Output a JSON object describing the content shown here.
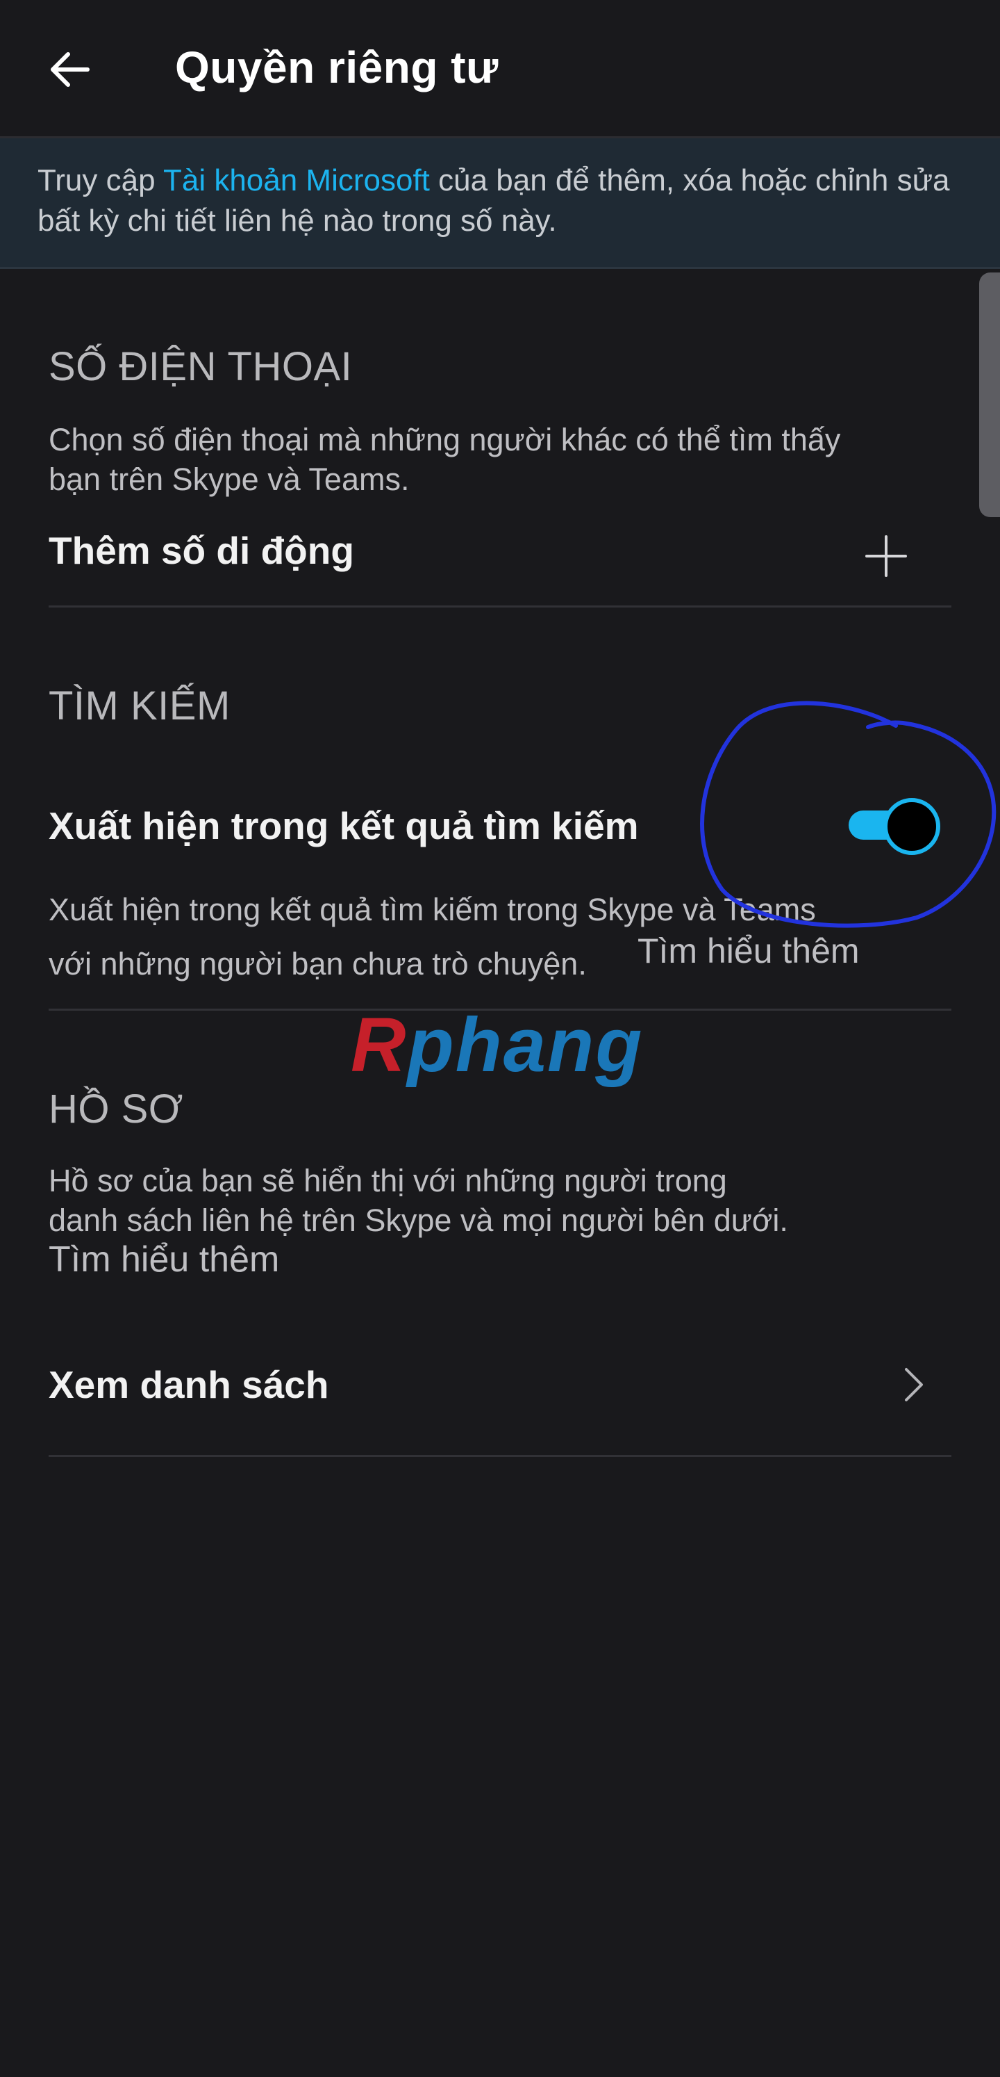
{
  "header": {
    "back_icon": "arrow-left-icon",
    "title": "Quyền riêng tư"
  },
  "banner": {
    "text_before": "Truy cập ",
    "link": "Tài khoản Microsoft",
    "text_after": " của bạn để thêm, xóa hoặc chỉnh sửa bất kỳ chi tiết liên hệ nào trong số này."
  },
  "phone": {
    "heading": "SỐ ĐIỆN THOẠI",
    "desc_line1": "Chọn số điện thoại mà những người khác có thể tìm thấy",
    "desc_line2": "bạn trên Skype và Teams.",
    "add_label": "Thêm số di động",
    "add_icon": "plus-icon"
  },
  "search": {
    "heading": "TÌM KIẾM",
    "toggle_label": "Xuất hiện trong kết quả tìm kiếm",
    "toggle_on": true,
    "desc_line1": "Xuất hiện trong kết quả tìm kiếm trong Skype và Teams",
    "desc_line2": "với những người bạn chưa trò chuyện.",
    "learn_more": "Tìm hiểu thêm"
  },
  "profile": {
    "heading": "HỒ SƠ",
    "desc_line1": "Hồ sơ của bạn sẽ hiển thị với những người trong",
    "desc_line2": "danh sách liên hệ trên Skype và mọi người bên dưới.",
    "learn_more": "Tìm hiểu thêm",
    "view_list": "Xem danh sách",
    "chevron_icon": "chevron-right-icon"
  },
  "watermark": {
    "part1": "R",
    "part2": "phang"
  },
  "colors": {
    "background": "#19191c",
    "accent": "#1cb3ef",
    "banner": "#1f2a34",
    "annotation": "#2233dd"
  }
}
